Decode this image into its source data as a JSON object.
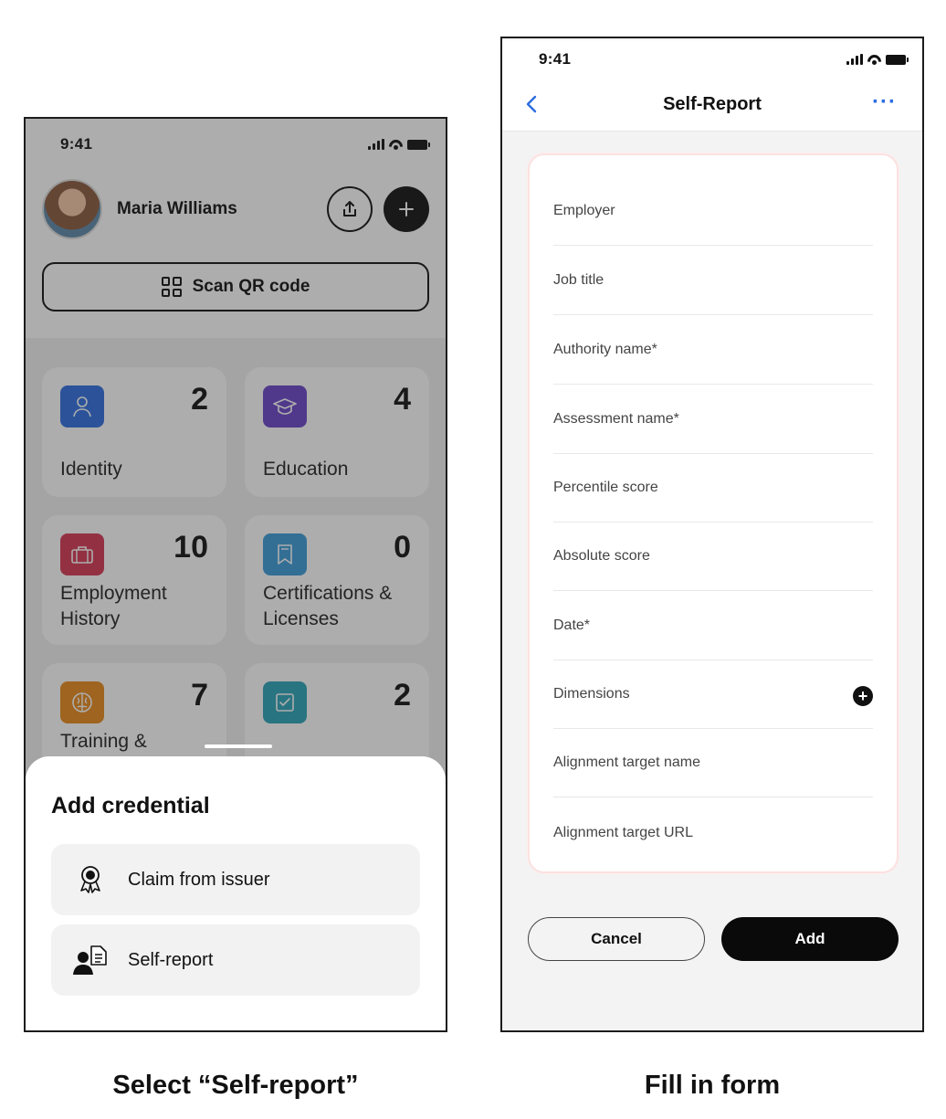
{
  "left_phone": {
    "status": {
      "time": "9:41"
    },
    "profile": {
      "name": "Maria Williams"
    },
    "scan_label": "Scan QR code",
    "cards": [
      {
        "label": "Identity",
        "count": "2",
        "color": "#2f6fe0",
        "icon": "person-icon"
      },
      {
        "label": "Education",
        "count": "4",
        "color": "#6a44c9",
        "icon": "graduation-cap-icon"
      },
      {
        "label": "Employment History",
        "count": "10",
        "color": "#d63753",
        "icon": "briefcase-icon"
      },
      {
        "label": "Certifications & Licenses",
        "count": "0",
        "color": "#3a9bd8",
        "icon": "bookmark-icon"
      },
      {
        "label": "Training &",
        "count": "7",
        "color": "#e88a1a",
        "icon": "brain-icon"
      },
      {
        "label": "",
        "count": "2",
        "color": "#2aa3b8",
        "icon": "checklist-icon"
      }
    ],
    "sheet": {
      "title": "Add credential",
      "options": [
        {
          "label": "Claim from issuer",
          "icon": "award-ribbon-icon"
        },
        {
          "label": "Self-report",
          "icon": "person-document-icon"
        }
      ]
    }
  },
  "right_phone": {
    "status": {
      "time": "9:41"
    },
    "nav": {
      "title": "Self-Report",
      "more": "···"
    },
    "fields": [
      {
        "label": "Employer"
      },
      {
        "label": "Job title"
      },
      {
        "label": "Authority name*"
      },
      {
        "label": "Assessment name*"
      },
      {
        "label": "Percentile score"
      },
      {
        "label": "Absolute score"
      },
      {
        "label": "Date*"
      },
      {
        "label": "Dimensions"
      },
      {
        "label": "Alignment target name"
      },
      {
        "label": "Alignment target URL"
      }
    ],
    "buttons": {
      "cancel": "Cancel",
      "add": "Add"
    }
  },
  "captions": {
    "left": "Select “Self-report”",
    "right": "Fill in form"
  }
}
